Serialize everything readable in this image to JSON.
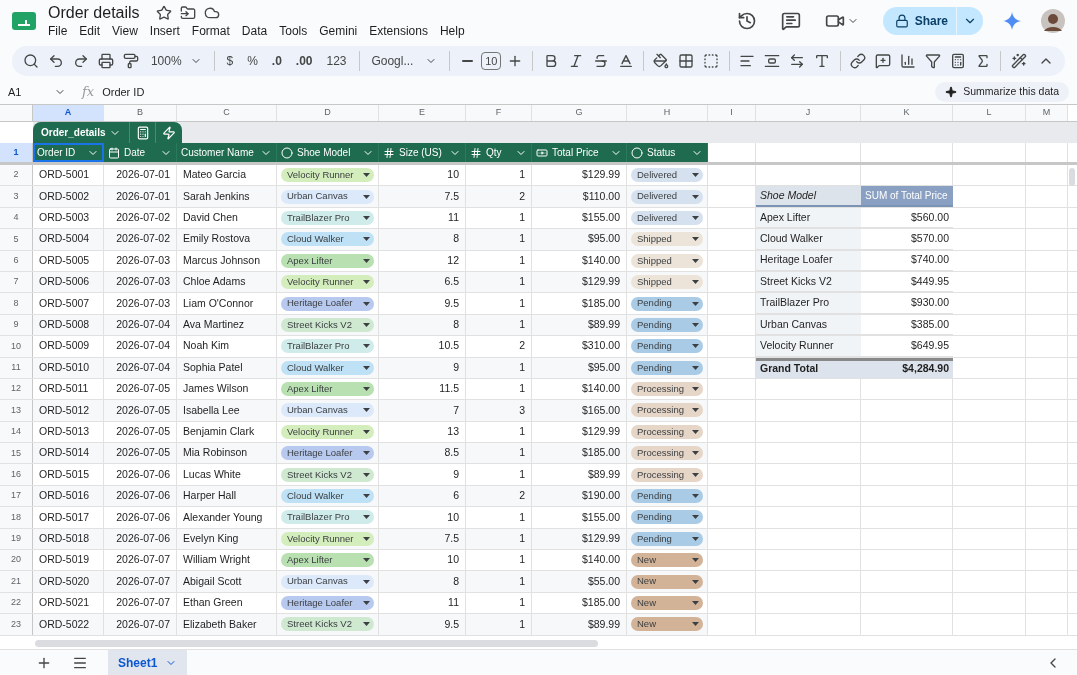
{
  "doc": {
    "title": "Order details",
    "menu": [
      "File",
      "Edit",
      "View",
      "Insert",
      "Format",
      "Data",
      "Tools",
      "Gemini",
      "Extensions",
      "Help"
    ],
    "share": "Share"
  },
  "toolbar": {
    "zoom": "100%",
    "currency": "$",
    "percent": "%",
    "decrease_decimals": ".0",
    "increase_decimals": ".00",
    "number_format": "123",
    "font": "Googl...",
    "font_size": "10"
  },
  "formula_bar": {
    "cell": "A1",
    "fx": "fx",
    "value": "Order ID",
    "summarize": "Summarize this data"
  },
  "column_letters": [
    {
      "label": "A",
      "selected": true
    },
    {
      "label": "B",
      "selected": false
    },
    {
      "label": "C",
      "selected": false
    },
    {
      "label": "D",
      "selected": false
    },
    {
      "label": "E",
      "selected": false
    },
    {
      "label": "F",
      "selected": false
    },
    {
      "label": "G",
      "selected": false
    },
    {
      "label": "H",
      "selected": false
    },
    {
      "label": "I",
      "selected": false
    },
    {
      "label": "J",
      "selected": false
    },
    {
      "label": "K",
      "selected": false
    },
    {
      "label": "L",
      "selected": false
    },
    {
      "label": "M",
      "selected": false
    }
  ],
  "table": {
    "name": "Order_details",
    "columns": [
      {
        "label": "Order ID",
        "kind": "text"
      },
      {
        "label": "Date",
        "kind": "date"
      },
      {
        "label": "Customer Name",
        "kind": "text"
      },
      {
        "label": "Shoe Model",
        "kind": "dropdown"
      },
      {
        "label": "Size (US)",
        "kind": "number"
      },
      {
        "label": "Qty",
        "kind": "number"
      },
      {
        "label": "Total Price",
        "kind": "currency"
      },
      {
        "label": "Status",
        "kind": "dropdown"
      }
    ],
    "header_row": {
      "n": "1",
      "selected": true
    },
    "rows": [
      {
        "n": "2",
        "cells": [
          "ORD-5001",
          "2026-07-01",
          "Mateo Garcia",
          {
            "label": "Velocity Runner",
            "color": "#d4edbc"
          },
          "10",
          "1",
          "$129.99",
          {
            "label": "Delivered",
            "color": "#d6e1ef"
          }
        ]
      },
      {
        "n": "3",
        "cells": [
          "ORD-5002",
          "2026-07-01",
          "Sarah Jenkins",
          {
            "label": "Urban Canvas",
            "color": "#dbe9fb"
          },
          "7.5",
          "2",
          "$110.00",
          {
            "label": "Delivered",
            "color": "#d6e1ef"
          }
        ]
      },
      {
        "n": "4",
        "cells": [
          "ORD-5003",
          "2026-07-02",
          "David Chen",
          {
            "label": "TrailBlazer Pro",
            "color": "#d0ecea"
          },
          "11",
          "1",
          "$155.00",
          {
            "label": "Delivered",
            "color": "#d6e1ef"
          }
        ]
      },
      {
        "n": "5",
        "cells": [
          "ORD-5004",
          "2026-07-02",
          "Emily Rostova",
          {
            "label": "Cloud Walker",
            "color": "#bfe1f6"
          },
          "8",
          "1",
          "$95.00",
          {
            "label": "Shipped",
            "color": "#ece4d8"
          }
        ]
      },
      {
        "n": "6",
        "cells": [
          "ORD-5005",
          "2026-07-03",
          "Marcus Johnson",
          {
            "label": "Apex Lifter",
            "color": "#b8e0b0"
          },
          "12",
          "1",
          "$140.00",
          {
            "label": "Shipped",
            "color": "#ece4d8"
          }
        ]
      },
      {
        "n": "7",
        "cells": [
          "ORD-5006",
          "2026-07-03",
          "Chloe Adams",
          {
            "label": "Velocity Runner",
            "color": "#d4edbc"
          },
          "6.5",
          "1",
          "$129.99",
          {
            "label": "Shipped",
            "color": "#ece4d8"
          }
        ]
      },
      {
        "n": "8",
        "cells": [
          "ORD-5007",
          "2026-07-03",
          "Liam O'Connor",
          {
            "label": "Heritage Loafer",
            "color": "#b7c9ee"
          },
          "9.5",
          "1",
          "$185.00",
          {
            "label": "Pending",
            "color": "#a9cbe6"
          }
        ]
      },
      {
        "n": "9",
        "cells": [
          "ORD-5008",
          "2026-07-04",
          "Ava Martinez",
          {
            "label": "Street Kicks V2",
            "color": "#cfe8d0"
          },
          "8",
          "1",
          "$89.99",
          {
            "label": "Pending",
            "color": "#a9cbe6"
          }
        ]
      },
      {
        "n": "10",
        "cells": [
          "ORD-5009",
          "2026-07-04",
          "Noah Kim",
          {
            "label": "TrailBlazer Pro",
            "color": "#d0ecea"
          },
          "10.5",
          "2",
          "$310.00",
          {
            "label": "Pending",
            "color": "#a9cbe6"
          }
        ]
      },
      {
        "n": "11",
        "cells": [
          "ORD-5010",
          "2026-07-04",
          "Sophia Patel",
          {
            "label": "Cloud Walker",
            "color": "#bfe1f6"
          },
          "9",
          "1",
          "$95.00",
          {
            "label": "Pending",
            "color": "#a9cbe6"
          }
        ]
      },
      {
        "n": "12",
        "cells": [
          "ORD-5011",
          "2026-07-05",
          "James Wilson",
          {
            "label": "Apex Lifter",
            "color": "#b8e0b0"
          },
          "11.5",
          "1",
          "$140.00",
          {
            "label": "Processing",
            "color": "#e6d6c8"
          }
        ]
      },
      {
        "n": "13",
        "cells": [
          "ORD-5012",
          "2026-07-05",
          "Isabella Lee",
          {
            "label": "Urban Canvas",
            "color": "#dbe9fb"
          },
          "7",
          "3",
          "$165.00",
          {
            "label": "Processing",
            "color": "#e6d6c8"
          }
        ]
      },
      {
        "n": "14",
        "cells": [
          "ORD-5013",
          "2026-07-05",
          "Benjamin Clark",
          {
            "label": "Velocity Runner",
            "color": "#d4edbc"
          },
          "13",
          "1",
          "$129.99",
          {
            "label": "Processing",
            "color": "#e6d6c8"
          }
        ]
      },
      {
        "n": "15",
        "cells": [
          "ORD-5014",
          "2026-07-05",
          "Mia Robinson",
          {
            "label": "Heritage Loafer",
            "color": "#b7c9ee"
          },
          "8.5",
          "1",
          "$185.00",
          {
            "label": "Processing",
            "color": "#e6d6c8"
          }
        ]
      },
      {
        "n": "16",
        "cells": [
          "ORD-5015",
          "2026-07-06",
          "Lucas White",
          {
            "label": "Street Kicks V2",
            "color": "#cfe8d0"
          },
          "9",
          "1",
          "$89.99",
          {
            "label": "Processing",
            "color": "#e6d6c8"
          }
        ]
      },
      {
        "n": "17",
        "cells": [
          "ORD-5016",
          "2026-07-06",
          "Harper Hall",
          {
            "label": "Cloud Walker",
            "color": "#bfe1f6"
          },
          "6",
          "2",
          "$190.00",
          {
            "label": "Pending",
            "color": "#a9cbe6"
          }
        ]
      },
      {
        "n": "18",
        "cells": [
          "ORD-5017",
          "2026-07-06",
          "Alexander Young",
          {
            "label": "TrailBlazer Pro",
            "color": "#d0ecea"
          },
          "10",
          "1",
          "$155.00",
          {
            "label": "Pending",
            "color": "#a9cbe6"
          }
        ]
      },
      {
        "n": "19",
        "cells": [
          "ORD-5018",
          "2026-07-06",
          "Evelyn King",
          {
            "label": "Velocity Runner",
            "color": "#d4edbc"
          },
          "7.5",
          "1",
          "$129.99",
          {
            "label": "Pending",
            "color": "#a9cbe6"
          }
        ]
      },
      {
        "n": "20",
        "cells": [
          "ORD-5019",
          "2026-07-07",
          "William Wright",
          {
            "label": "Apex Lifter",
            "color": "#b8e0b0"
          },
          "10",
          "1",
          "$140.00",
          {
            "label": "New",
            "color": "#d3b398"
          }
        ]
      },
      {
        "n": "21",
        "cells": [
          "ORD-5020",
          "2026-07-07",
          "Abigail Scott",
          {
            "label": "Urban Canvas",
            "color": "#dbe9fb"
          },
          "8",
          "1",
          "$55.00",
          {
            "label": "New",
            "color": "#d3b398"
          }
        ]
      },
      {
        "n": "22",
        "cells": [
          "ORD-5021",
          "2026-07-07",
          "Ethan Green",
          {
            "label": "Heritage Loafer",
            "color": "#b7c9ee"
          },
          "11",
          "1",
          "$185.00",
          {
            "label": "New",
            "color": "#d3b398"
          }
        ]
      },
      {
        "n": "23",
        "cells": [
          "ORD-5022",
          "2026-07-07",
          "Elizabeth Baker",
          {
            "label": "Street Kicks V2",
            "color": "#cfe8d0"
          },
          "9.5",
          "1",
          "$89.99",
          {
            "label": "New",
            "color": "#d3b398"
          }
        ]
      }
    ]
  },
  "pivot": {
    "header": [
      "Shoe Model",
      "SUM of Total Price"
    ],
    "rows": [
      [
        "Apex Lifter",
        "$560.00"
      ],
      [
        "Cloud Walker",
        "$570.00"
      ],
      [
        "Heritage Loafer",
        "$740.00"
      ],
      [
        "Street Kicks V2",
        "$449.95"
      ],
      [
        "TrailBlazer Pro",
        "$930.00"
      ],
      [
        "Urban Canvas",
        "$385.00"
      ],
      [
        "Velocity Runner",
        "$649.95"
      ]
    ],
    "total": [
      "Grand Total",
      "$4,284.90"
    ]
  },
  "sheet_tabs": [
    {
      "label": "Sheet1",
      "selected": true
    }
  ]
}
